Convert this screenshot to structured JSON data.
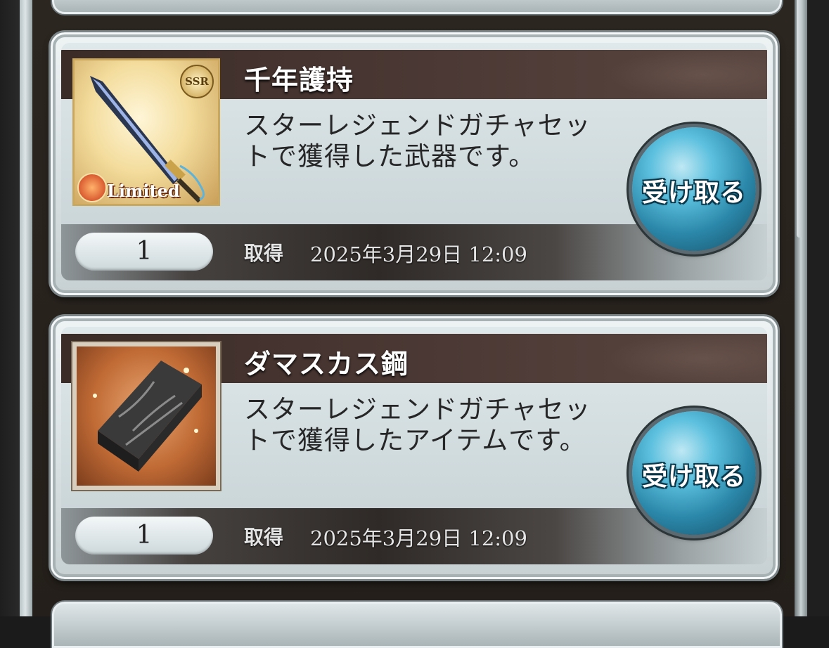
{
  "rewards": [
    {
      "name": "千年護持",
      "description": "スターレジェンドガチャセットで獲得した武器です。",
      "thumb_icon": "weapon-sword-icon",
      "rarity_badge": "SSR",
      "tag": "Limited",
      "quantity": "1",
      "acquired_label": "取得",
      "acquired_date": "2025年3月29日  12:09",
      "claim_label": "受け取る"
    },
    {
      "name": "ダマスカス鋼",
      "description": "スターレジェンドガチャセットで獲得したアイテムです。",
      "thumb_icon": "damascus-steel-ingot-icon",
      "quantity": "1",
      "acquired_label": "取得",
      "acquired_date": "2025年3月29日  12:09",
      "claim_label": "受け取る"
    }
  ]
}
